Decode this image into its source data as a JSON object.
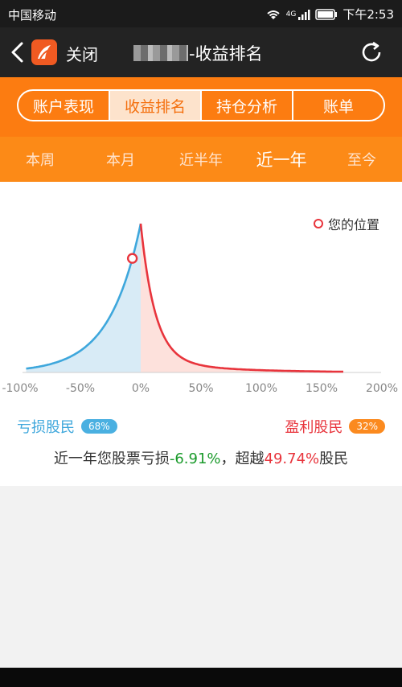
{
  "status_bar": {
    "carrier": "中国移动",
    "network": "4G",
    "time": "下午2:53"
  },
  "title_bar": {
    "close_label": "关闭",
    "title": "-收益排名",
    "logo_icon": "app-logo-icon",
    "back_icon": "chevron-left-icon",
    "refresh_icon": "refresh-icon"
  },
  "tabs": [
    "账户表现",
    "收益排名",
    "持仓分析",
    "账单"
  ],
  "active_tab": "收益排名",
  "periods": [
    "本周",
    "本月",
    "近半年",
    "近一年",
    "至今"
  ],
  "active_period": "近一年",
  "legend": {
    "position_label": "您的位置"
  },
  "chart_data": {
    "type": "area",
    "x_ticks": [
      "-100%",
      "-50%",
      "0%",
      "50%",
      "100%",
      "150%",
      "200%"
    ],
    "xlim": [
      -100,
      200
    ],
    "user_position_pct": -6.91,
    "series": [
      {
        "color": "#3ea7dc",
        "region": "loss"
      },
      {
        "color": "#e8343c",
        "region": "gain"
      }
    ]
  },
  "loss": {
    "label": "亏损股民",
    "percent": "68%"
  },
  "gain": {
    "label": "盈利股民",
    "percent": "32%"
  },
  "summary": {
    "prefix": "近一年您股票亏损",
    "return_value": "-6.91%",
    "middle": "，超越",
    "beat_value": "49.74%",
    "suffix": "股民"
  },
  "colors": {
    "orange": "#fc7c11",
    "loss_blue": "#3ea7dc",
    "gain_red": "#e8343c"
  }
}
